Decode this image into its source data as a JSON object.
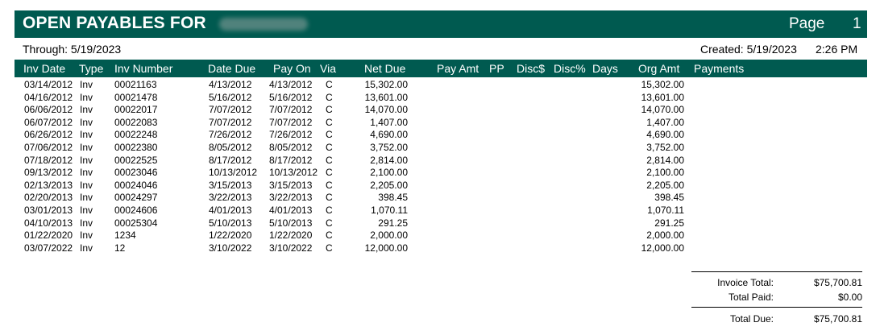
{
  "header": {
    "title": "OPEN PAYABLES FOR",
    "page_label": "Page",
    "page_number": "1"
  },
  "info": {
    "through": "Through:  5/19/2023",
    "created": "Created:  5/19/2023",
    "created_time": "2:26 PM"
  },
  "columns": {
    "inv_date": "Inv Date",
    "type": "Type",
    "inv_number": "Inv Number",
    "date_due": "Date Due",
    "pay_on": "Pay On",
    "via": "Via",
    "net_due": "Net Due",
    "pay_amt": "Pay Amt",
    "pp": "PP",
    "disc_dollar": "Disc$",
    "disc_pct": "Disc%",
    "days": "Days",
    "org_amt": "Org Amt",
    "payments": "Payments"
  },
  "rows": [
    {
      "inv_date": "03/14/2012",
      "type": "Inv",
      "inv_number": "00021163",
      "date_due": "4/13/2012",
      "pay_on": "4/13/2012",
      "via": "C",
      "net_due": "15,302.00",
      "org_amt": "15,302.00"
    },
    {
      "inv_date": "04/16/2012",
      "type": "Inv",
      "inv_number": "00021478",
      "date_due": "5/16/2012",
      "pay_on": "5/16/2012",
      "via": "C",
      "net_due": "13,601.00",
      "org_amt": "13,601.00"
    },
    {
      "inv_date": "06/06/2012",
      "type": "Inv",
      "inv_number": "00022017",
      "date_due": "7/07/2012",
      "pay_on": "7/07/2012",
      "via": "C",
      "net_due": "14,070.00",
      "org_amt": "14,070.00"
    },
    {
      "inv_date": "06/07/2012",
      "type": "Inv",
      "inv_number": "00022083",
      "date_due": "7/07/2012",
      "pay_on": "7/07/2012",
      "via": "C",
      "net_due": "1,407.00",
      "org_amt": "1,407.00"
    },
    {
      "inv_date": "06/26/2012",
      "type": "Inv",
      "inv_number": "00022248",
      "date_due": "7/26/2012",
      "pay_on": "7/26/2012",
      "via": "C",
      "net_due": "4,690.00",
      "org_amt": "4,690.00"
    },
    {
      "inv_date": "07/06/2012",
      "type": "Inv",
      "inv_number": "00022380",
      "date_due": "8/05/2012",
      "pay_on": "8/05/2012",
      "via": "C",
      "net_due": "3,752.00",
      "org_amt": "3,752.00"
    },
    {
      "inv_date": "07/18/2012",
      "type": "Inv",
      "inv_number": "00022525",
      "date_due": "8/17/2012",
      "pay_on": "8/17/2012",
      "via": "C",
      "net_due": "2,814.00",
      "org_amt": "2,814.00"
    },
    {
      "inv_date": "09/13/2012",
      "type": "Inv",
      "inv_number": "00023046",
      "date_due": "10/13/2012",
      "pay_on": "10/13/2012",
      "via": "C",
      "net_due": "2,100.00",
      "org_amt": "2,100.00"
    },
    {
      "inv_date": "02/13/2013",
      "type": "Inv",
      "inv_number": "00024046",
      "date_due": "3/15/2013",
      "pay_on": "3/15/2013",
      "via": "C",
      "net_due": "2,205.00",
      "org_amt": "2,205.00"
    },
    {
      "inv_date": "02/20/2013",
      "type": "Inv",
      "inv_number": "00024297",
      "date_due": "3/22/2013",
      "pay_on": "3/22/2013",
      "via": "C",
      "net_due": "398.45",
      "org_amt": "398.45"
    },
    {
      "inv_date": "03/01/2013",
      "type": "Inv",
      "inv_number": "00024606",
      "date_due": "4/01/2013",
      "pay_on": "4/01/2013",
      "via": "C",
      "net_due": "1,070.11",
      "org_amt": "1,070.11"
    },
    {
      "inv_date": "04/10/2013",
      "type": "Inv",
      "inv_number": "00025304",
      "date_due": "5/10/2013",
      "pay_on": "5/10/2013",
      "via": "C",
      "net_due": "291.25",
      "org_amt": "291.25"
    },
    {
      "inv_date": "01/22/2020",
      "type": "Inv",
      "inv_number": "1234",
      "date_due": "1/22/2020",
      "pay_on": "1/22/2020",
      "via": "C",
      "net_due": "2,000.00",
      "org_amt": "2,000.00"
    },
    {
      "inv_date": "03/07/2022",
      "type": "Inv",
      "inv_number": "12",
      "date_due": "3/10/2022",
      "pay_on": "3/10/2022",
      "via": "C",
      "net_due": "12,000.00",
      "org_amt": "12,000.00"
    }
  ],
  "totals": {
    "invoice_total_label": "Invoice Total:",
    "invoice_total": "$75,700.81",
    "total_paid_label": "Total Paid:",
    "total_paid": "$0.00",
    "total_due_label": "Total Due:",
    "total_due": "$75,700.81"
  },
  "colors": {
    "header_bg": "#005a50"
  }
}
